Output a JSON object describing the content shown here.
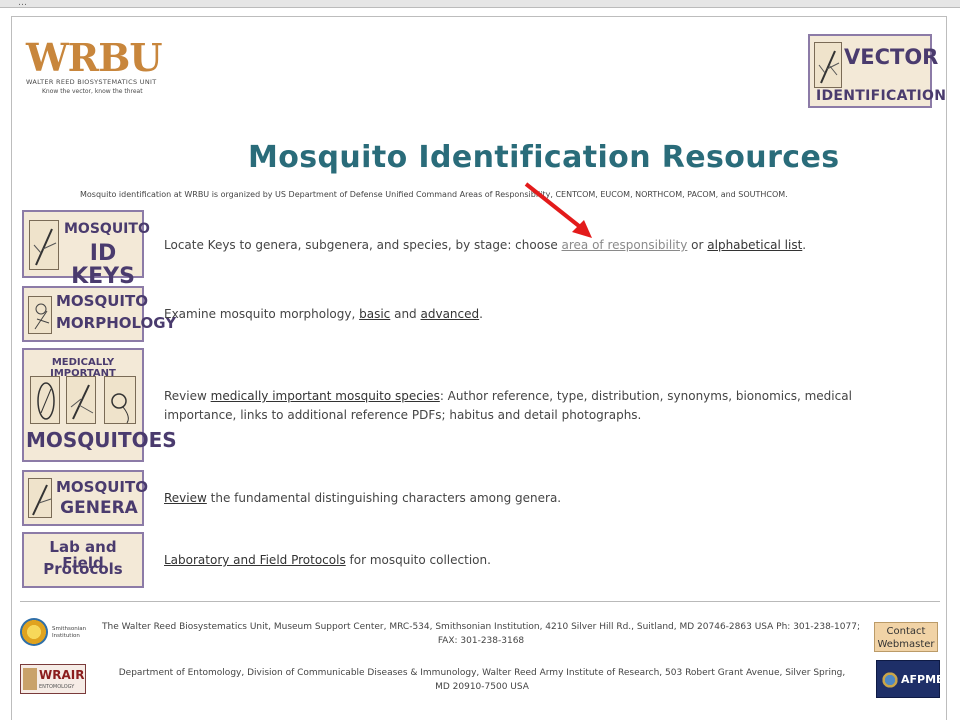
{
  "browser": {
    "chrome_text": "…"
  },
  "header": {
    "logo_big": "WRBU",
    "logo_unit": "WALTER REED BIOSYSTEMATICS UNIT",
    "logo_tagline": "Know the vector, know the threat",
    "vector_line1": "VECTOR",
    "vector_line2": "IDENTIFICATION"
  },
  "page": {
    "title": "Mosquito Identification Resources",
    "subtitle": "Mosquito identification at WRBU is organized by US Department of Defense Unified Command Areas of Responsibility, CENTCOM, EUCOM, NORTHCOM, PACOM, and SOUTHCOM."
  },
  "rows": [
    {
      "tile_line1": "MOSQUITO",
      "tile_line2": "ID KEYS",
      "pre": "Locate Keys to genera, subgenera, and species, by stage: choose ",
      "link1": "area of responsibility",
      "mid": " or ",
      "link2": "alphabetical list",
      "post": "."
    },
    {
      "tile_line1": "MOSQUITO",
      "tile_line2": "MORPHOLOGY",
      "pre": "Examine mosquito morphology, ",
      "link1": "basic",
      "mid": " and ",
      "link2": "advanced",
      "post": "."
    },
    {
      "tile_line1": "MEDICALLY IMPORTANT",
      "tile_line2": "MOSQUITOES",
      "pre": "Review ",
      "link1": "medically important mosquito species",
      "post": ": Author reference, type, distribution, synonyms, bionomics, medical importance, links to additional reference PDFs; habitus and detail photographs."
    },
    {
      "tile_line1": "MOSQUITO",
      "tile_line2": "GENERA",
      "link1": "Review",
      "post": " the fundamental distinguishing characters among genera."
    },
    {
      "tile_line1": "Lab and Field",
      "tile_line2": "Protocols",
      "link1": "Laboratory and Field Protocols",
      "post": " for mosquito collection."
    }
  ],
  "footer": {
    "smithsonian_label": "Smithsonian Institution",
    "address1": "The Walter Reed Biosystematics Unit, Museum Support Center, MRC-534, Smithsonian Institution, 4210 Silver Hill Rd., Suitland, MD 20746-2863 USA Ph: 301-238-1077; FAX: 301-238-3168",
    "address2": "Department of Entomology, Division of Communicable Diseases & Immunology, Walter Reed Army Institute of Research, 503 Robert Grant Avenue, Silver Spring, MD 20910-7500 USA",
    "wrair_label": "WRAIR",
    "wrair_sub": "ENTOMOLOGY",
    "contact_line1": "Contact",
    "contact_line2": "Webmaster",
    "afpmb_label": "AFPMB"
  },
  "colors": {
    "title": "#2a6c7a",
    "tile_border": "#8c7ba7",
    "tile_bg": "#f3e9d7",
    "tile_text": "#4a3b6e",
    "arrow": "#e31b1b"
  }
}
